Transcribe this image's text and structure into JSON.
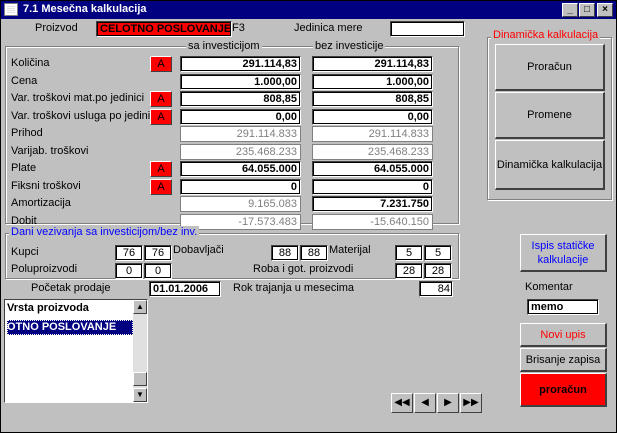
{
  "window": {
    "title": "7.1 Mesečna kalkulacija",
    "btn_min": "_",
    "btn_max": "□",
    "btn_close": "×"
  },
  "header": {
    "proizvod_label": "Proizvod",
    "proizvod_value": "CELOTNO POSLOVANJE",
    "f3_label": "F3",
    "jedinica_label": "Jedinica mere",
    "jedinica_value": ""
  },
  "columns": {
    "sa": "sa investicijom",
    "bez": "bez investicije"
  },
  "rows": [
    {
      "label": "Količina",
      "sa": "291.114,83",
      "bez": "291.114,83",
      "btn": "A",
      "style": "input"
    },
    {
      "label": "Cena",
      "sa": "1.000,00",
      "bez": "1.000,00",
      "btn": "",
      "style": "input"
    },
    {
      "label": "Var. troškovi mat.po jedinici",
      "sa": "808,85",
      "bez": "808,85",
      "btn": "A",
      "style": "input"
    },
    {
      "label": "Var. troškovi usluga po jedinici",
      "sa": "0,00",
      "bez": "0,00",
      "btn": "A",
      "style": "input"
    },
    {
      "label": "Prihod",
      "sa": "291.114.833",
      "bez": "291.114.833",
      "btn": "",
      "style": "gray"
    },
    {
      "label": "Varijab. troškovi",
      "sa": "235.468.233",
      "bez": "235.468.233",
      "btn": "",
      "style": "gray"
    },
    {
      "label": "Plate",
      "sa": "64.055.000",
      "bez": "64.055.000",
      "btn": "A",
      "style": "input"
    },
    {
      "label": "Fiksni troškovi",
      "sa": "0",
      "bez": "0",
      "btn": "A",
      "style": "input"
    },
    {
      "label": "Amortizacija",
      "sa": "9.165.083",
      "bez": "7.231.750",
      "btn": "",
      "style": "mixed"
    },
    {
      "label": "Dobit",
      "sa": "-17.573.483",
      "bez": "-15.640.150",
      "btn": "",
      "style": "gray"
    }
  ],
  "dani": {
    "title": "Dani vezivanja sa investicijom/bez inv.",
    "kupci_label": "Kupci",
    "kupci_a": "76",
    "kupci_b": "76",
    "dobavljaci_label": "Dobavljači",
    "dobavljaci_a": "88",
    "dobavljaci_b": "88",
    "materijal_label": "Materijal",
    "materijal_a": "5",
    "materijal_b": "5",
    "poluproizvodi_label": "Poluproizvodi",
    "poluproizvodi_a": "0",
    "poluproizvodi_b": "0",
    "roba_label": "Roba i got. proizvodi",
    "roba_a": "28",
    "roba_b": "28"
  },
  "pocetak": {
    "label": "Početak prodaje",
    "value": "01.01.2006",
    "rok_label": "Rok trajanja u mesecima",
    "rok_value": "84"
  },
  "vrsta": {
    "header": "Vrsta proizvoda",
    "selected": "OTNO POSLOVANJE"
  },
  "dinamicka": {
    "title": "Dinamička kalkulacija",
    "proracun": "Proračun",
    "promene": "Promene",
    "dinamicka_kalk": "Dinamička kalkulacija"
  },
  "right": {
    "ispis": "Ispis statičke kalkulacije",
    "komentar_label": "Komentar",
    "komentar_value": "memo",
    "novi_upis": "Novi upis",
    "brisanje": "Brisanje zapisa",
    "proracun": "proračun"
  },
  "nav": {
    "first": "◀◀",
    "prev": "◀",
    "next": "▶",
    "last": "▶▶"
  },
  "colors": {
    "title_bar": "#000080",
    "red": "#ff0000",
    "ispis_text": "#0000ff"
  }
}
